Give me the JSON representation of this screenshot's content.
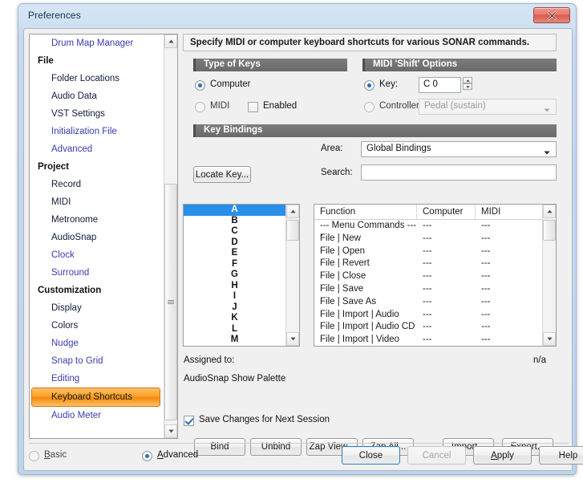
{
  "window": {
    "title": "Preferences",
    "close_icon": "close-x-icon"
  },
  "sidebar": {
    "items": [
      {
        "label": "Drum Map Manager",
        "type": "link",
        "selected": false
      },
      {
        "label": "File",
        "type": "category",
        "selected": false
      },
      {
        "label": "Folder Locations",
        "type": "plain",
        "selected": false
      },
      {
        "label": "Audio Data",
        "type": "plain",
        "selected": false
      },
      {
        "label": "VST Settings",
        "type": "plain",
        "selected": false
      },
      {
        "label": "Initialization File",
        "type": "link",
        "selected": false
      },
      {
        "label": "Advanced",
        "type": "link",
        "selected": false
      },
      {
        "label": "Project",
        "type": "category",
        "selected": false
      },
      {
        "label": "Record",
        "type": "plain",
        "selected": false
      },
      {
        "label": "MIDI",
        "type": "plain",
        "selected": false
      },
      {
        "label": "Metronome",
        "type": "plain",
        "selected": false
      },
      {
        "label": "AudioSnap",
        "type": "plain",
        "selected": false
      },
      {
        "label": "Clock",
        "type": "link",
        "selected": false
      },
      {
        "label": "Surround",
        "type": "link",
        "selected": false
      },
      {
        "label": "Customization",
        "type": "category",
        "selected": false
      },
      {
        "label": "Display",
        "type": "plain",
        "selected": false
      },
      {
        "label": "Colors",
        "type": "plain",
        "selected": false
      },
      {
        "label": "Nudge",
        "type": "link",
        "selected": false
      },
      {
        "label": "Snap to Grid",
        "type": "link",
        "selected": false
      },
      {
        "label": "Editing",
        "type": "link",
        "selected": false
      },
      {
        "label": "Keyboard Shortcuts",
        "type": "link",
        "selected": true
      },
      {
        "label": "Audio Meter",
        "type": "link",
        "selected": false
      }
    ],
    "selected_accent": "#f08a0c"
  },
  "main": {
    "hint": "Specify MIDI or computer keyboard shortcuts for various SONAR commands.",
    "type_of_keys": {
      "title": "Type of Keys",
      "computer_label": "Computer",
      "computer_selected": true,
      "midi_label": "MIDI",
      "midi_selected": false,
      "enabled_label": "Enabled",
      "enabled_checked": false
    },
    "midi_shift_options": {
      "title": "MIDI 'Shift' Options",
      "key_label": "Key:",
      "key_selected": true,
      "key_value": "C 0",
      "controller_label": "Controller:",
      "controller_selected": false,
      "controller_value": "Pedal (sustain)"
    },
    "key_bindings": {
      "title": "Key Bindings",
      "area_label": "Area:",
      "area_value": "Global Bindings",
      "search_label": "Search:",
      "search_value": "",
      "search_placeholder": "",
      "locate_key_label": "Locate Key...",
      "keys": [
        "A",
        "B",
        "C",
        "D",
        "E",
        "F",
        "G",
        "H",
        "I",
        "J",
        "K",
        "L",
        "M"
      ],
      "selected_key": "A",
      "grid_headers": [
        "Function",
        "Computer",
        "MIDI"
      ],
      "grid_rows": [
        [
          "--- Menu Commands ----",
          "---",
          "---"
        ],
        [
          "File | New",
          "---",
          "---"
        ],
        [
          "File | Open",
          "---",
          "---"
        ],
        [
          "File | Revert",
          "---",
          "---"
        ],
        [
          "File | Close",
          "---",
          "---"
        ],
        [
          "File | Save",
          "---",
          "---"
        ],
        [
          "File | Save As",
          "---",
          "---"
        ],
        [
          "File | Import | Audio",
          "---",
          "---"
        ],
        [
          "File | Import | Audio CD",
          "---",
          "---"
        ],
        [
          "File | Import | Video",
          "---",
          "---"
        ]
      ],
      "assigned_to_label": "Assigned to:",
      "assigned_to_value": "n/a",
      "assigned_detail": "AudioSnap Show Palette",
      "save_changes_label": "Save Changes for Next Session",
      "save_changes_checked": true,
      "buttons": {
        "bind": "Bind",
        "unbind": "Unbind",
        "zap_view": "Zap View...",
        "zap_all": "Zap All...",
        "import": "Import...",
        "export": "Export..."
      }
    }
  },
  "footer": {
    "basic_label": "Basic",
    "basic_accel": "B",
    "basic_selected": false,
    "advanced_label": "Advanced",
    "advanced_accel": "A",
    "advanced_selected": true,
    "close_label": "Close",
    "cancel_label": "Cancel",
    "cancel_disabled": true,
    "apply_label": "Apply",
    "apply_accel": "A",
    "help_label": "Help"
  }
}
